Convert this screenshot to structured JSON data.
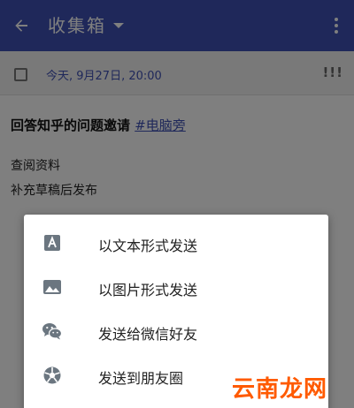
{
  "app_bar": {
    "title": "收集箱",
    "back_icon": "arrow-back-icon",
    "menu_icon": "more-vert-icon",
    "color": "#3f51b5"
  },
  "note": {
    "date": "今天, 9月27日, 20:00",
    "priority": "!!!",
    "title_text": "回答知乎的问题邀请 ",
    "tag": "#电脑旁",
    "lines": [
      "查阅资料",
      "补充草稿后发布"
    ]
  },
  "share_menu": {
    "items": [
      {
        "label": "以文本形式发送",
        "icon": "text-icon"
      },
      {
        "label": "以图片形式发送",
        "icon": "image-icon"
      },
      {
        "label": "发送给微信好友",
        "icon": "wechat-icon"
      },
      {
        "label": "发送到朋友圈",
        "icon": "moments-icon"
      }
    ]
  },
  "watermark": "云南龙网"
}
